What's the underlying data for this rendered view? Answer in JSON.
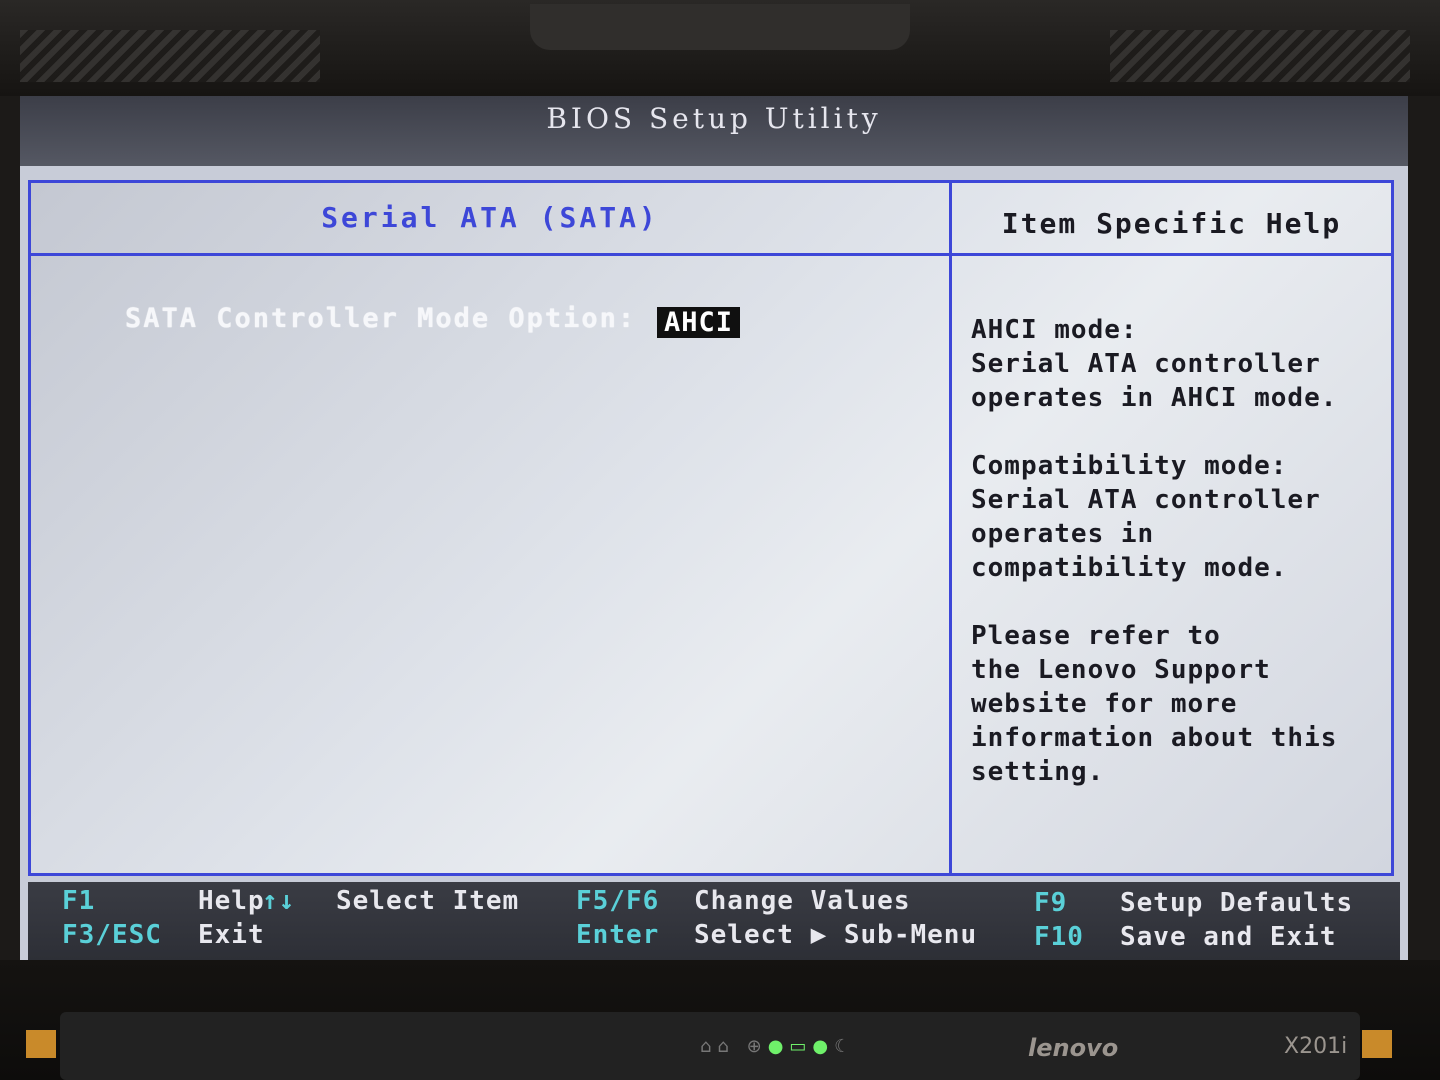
{
  "title": "BIOS Setup Utility",
  "section_title": "Serial ATA (SATA)",
  "help_title": "Item Specific Help",
  "option": {
    "label": "SATA Controller Mode Option:",
    "value": "AHCI"
  },
  "help": [
    "AHCI mode:\nSerial ATA controller\noperates in AHCI mode.",
    "Compatibility mode:\nSerial ATA controller\noperates in\ncompatibility mode.",
    "Please refer to\nthe Lenovo Support\nwebsite for more\ninformation about this\nsetting."
  ],
  "footer": {
    "f1_key": "F1",
    "f1_desc": "Help",
    "arrows_key": "↑↓",
    "arrows_desc": "Select Item",
    "f5f6_key": "F5/F6",
    "f5f6_desc": "Change Values",
    "f9_key": "F9",
    "f9_desc": "Setup Defaults",
    "f3_key": "F3/ESC",
    "f3_desc": "Exit",
    "enter_key": "Enter",
    "enter_desc": "Select ▶ Sub-Menu",
    "f10_key": "F10",
    "f10_desc": "Save and Exit"
  },
  "laptop": {
    "brand": "lenovo",
    "model": "X201i"
  },
  "colors": {
    "border_blue": "#3d47d8",
    "key_cyan": "#5ad0d8",
    "panel_bg": "#dfe3ea"
  }
}
